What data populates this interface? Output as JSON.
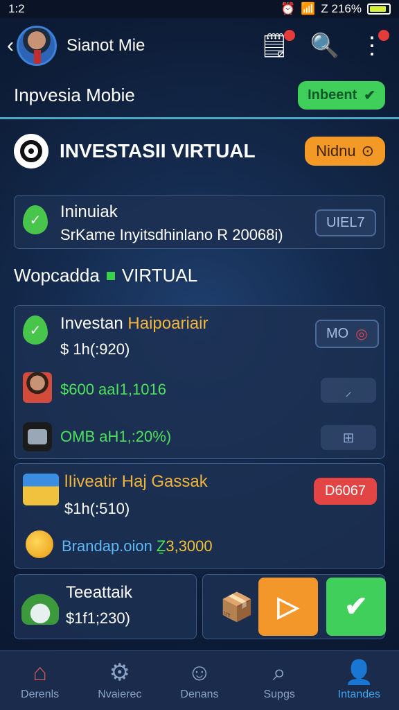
{
  "status": {
    "time": "1:2",
    "battery": "Z 216%"
  },
  "header": {
    "name": "Sianot Mie"
  },
  "subheader": {
    "title": "Inpvesia Mobie",
    "button": "Inbeent"
  },
  "section1": {
    "title": "INVESTASII VIRTUAL",
    "button": "Nidnu"
  },
  "info_card": {
    "title": "Ininuiak",
    "subtitle": "SrKame Inyitsdhinlano R 20068i)",
    "button": "UIEL7"
  },
  "section2": {
    "title_prefix": "Wopcadda",
    "title_suffix": "VIRTUAL"
  },
  "card2": {
    "title_white": "Investan",
    "title_orange": "Haipoariair",
    "value": "$ 1h(:920)",
    "button": "MO",
    "row2": "$600 aaI1,1016",
    "row3": "OMB aH1,:20%)"
  },
  "card3": {
    "title": "lIiveatir Haj Gassak",
    "value": "$1h(:510)",
    "button": "D6067",
    "label": "Brandap.oion",
    "amount": "3,3000"
  },
  "card4": {
    "title": "Teeattaik",
    "value": "$1f1;230)"
  },
  "nav": [
    {
      "label": "Derenls",
      "icon": "home-icon"
    },
    {
      "label": "Nvaierec",
      "icon": "gear-icon"
    },
    {
      "label": "Denans",
      "icon": "person-icon"
    },
    {
      "label": "Supgs",
      "icon": "search-icon"
    },
    {
      "label": "Intandes",
      "icon": "user-group-icon"
    }
  ],
  "colors": {
    "accent_green": "#3fcf5a",
    "accent_orange": "#f39a26",
    "accent_red": "#e34545",
    "active_blue": "#3fa6f0"
  }
}
